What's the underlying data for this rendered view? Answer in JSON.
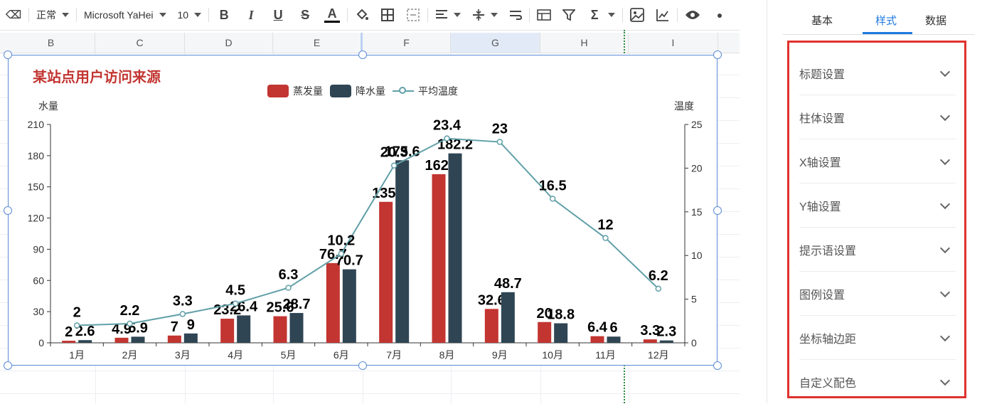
{
  "toolbar": {
    "style_select": "正常",
    "font_select": "Microsoft YaHei",
    "size_select": "10"
  },
  "columns": [
    "B",
    "C",
    "D",
    "E",
    "F",
    "G",
    "H",
    "I"
  ],
  "right_panel": {
    "tabs": [
      "基本",
      "样式",
      "数据"
    ],
    "active_tab": "样式",
    "sections": [
      "标题设置",
      "柱体设置",
      "X轴设置",
      "Y轴设置",
      "提示语设置",
      "图例设置",
      "坐标轴边距",
      "自定义配色"
    ]
  },
  "colors": {
    "evaporation": "#c23531",
    "precipitation": "#2f4554",
    "temperature": "#61a0a8",
    "accent": "#1f7ae0",
    "highlight_border": "#e0322e"
  },
  "chart_data": {
    "type": "bar",
    "title": "某站点用户访问来源",
    "categories": [
      "1月",
      "2月",
      "3月",
      "4月",
      "5月",
      "6月",
      "7月",
      "8月",
      "9月",
      "10月",
      "11月",
      "12月"
    ],
    "series": [
      {
        "name": "蒸发量",
        "type": "bar",
        "axis": "left",
        "values": [
          2,
          4.9,
          7,
          23.2,
          25.6,
          76.7,
          135.6,
          162.2,
          32.6,
          20,
          6.4,
          3.3
        ],
        "labels": [
          "2",
          "4.9",
          "7",
          "23.2",
          "25.6",
          "76.7",
          "135.",
          "162.",
          "32.6",
          "20",
          "6.4",
          "3.3"
        ]
      },
      {
        "name": "降水量",
        "type": "bar",
        "axis": "left",
        "values": [
          2.6,
          5.9,
          9,
          26.4,
          28.7,
          70.7,
          175.6,
          182.2,
          48.7,
          18.8,
          6,
          2.3
        ],
        "labels": [
          "2.6",
          "5.9",
          "9",
          "26.4",
          "28.7",
          "70.7",
          "175.6",
          "182.2",
          "48.7",
          "18.8",
          "6",
          "2.3"
        ]
      },
      {
        "name": "平均温度",
        "type": "line",
        "axis": "right",
        "values": [
          2,
          2.2,
          3.3,
          4.5,
          6.3,
          10.2,
          20.3,
          23.4,
          23,
          16.5,
          12,
          6.2
        ],
        "labels": [
          "2",
          "2.2",
          "3.3",
          "4.5",
          "6.3",
          "10.2",
          "20.3",
          "23.4",
          "23",
          "16.5",
          "12",
          "6.2"
        ]
      }
    ],
    "y_left": {
      "name": "水量",
      "min": 0,
      "max": 210,
      "ticks": [
        "0",
        "30",
        "60",
        "90",
        "120",
        "150",
        "180",
        "210"
      ]
    },
    "y_right": {
      "name": "温度",
      "min": 0,
      "max": 25,
      "ticks": [
        "0",
        "5",
        "10",
        "15",
        "20",
        "25"
      ]
    },
    "legend_position": "top-center",
    "grid": false
  }
}
